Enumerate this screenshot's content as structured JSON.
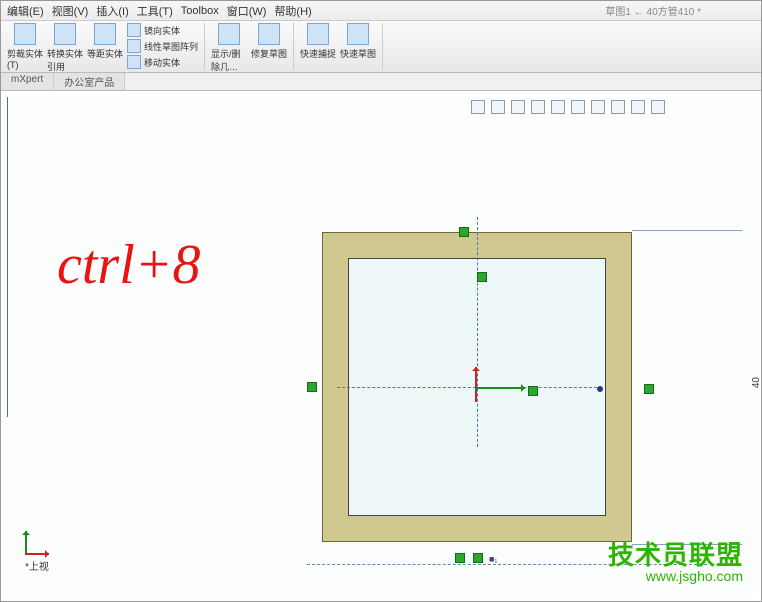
{
  "menu": {
    "edit": "编辑(E)",
    "view": "视图(V)",
    "insert": "插入(I)",
    "tools": "工具(T)",
    "toolbox": "Toolbox",
    "window": "窗口(W)",
    "help": "帮助(H)"
  },
  "breadcrumb": "草图1 ← 40方管410 *",
  "ribbon": {
    "group1": {
      "trim": {
        "label": "剪裁实体(T)",
        "sub1": "镜向实体",
        "sub2": "线性草图阵列",
        "sub3": "移动实体"
      },
      "convert": "转换实体引用",
      "offset": "等距实体"
    },
    "group2": {
      "show": "显示/删除几…",
      "repair": "修复草图"
    },
    "group3": {
      "quick1": "快速捕捉",
      "quick2": "快速草图"
    }
  },
  "subtabs": {
    "tab1": "mXpert",
    "tab2": "办公室产品"
  },
  "annotation": "ctrl+8",
  "dimension": "40",
  "viewlabel": "*上视",
  "watermark": {
    "line1": "技术员联盟",
    "line2": "www.jsgho.com"
  },
  "sketch_label_h": "■ ■₁",
  "sketch_label_r": "■₁"
}
